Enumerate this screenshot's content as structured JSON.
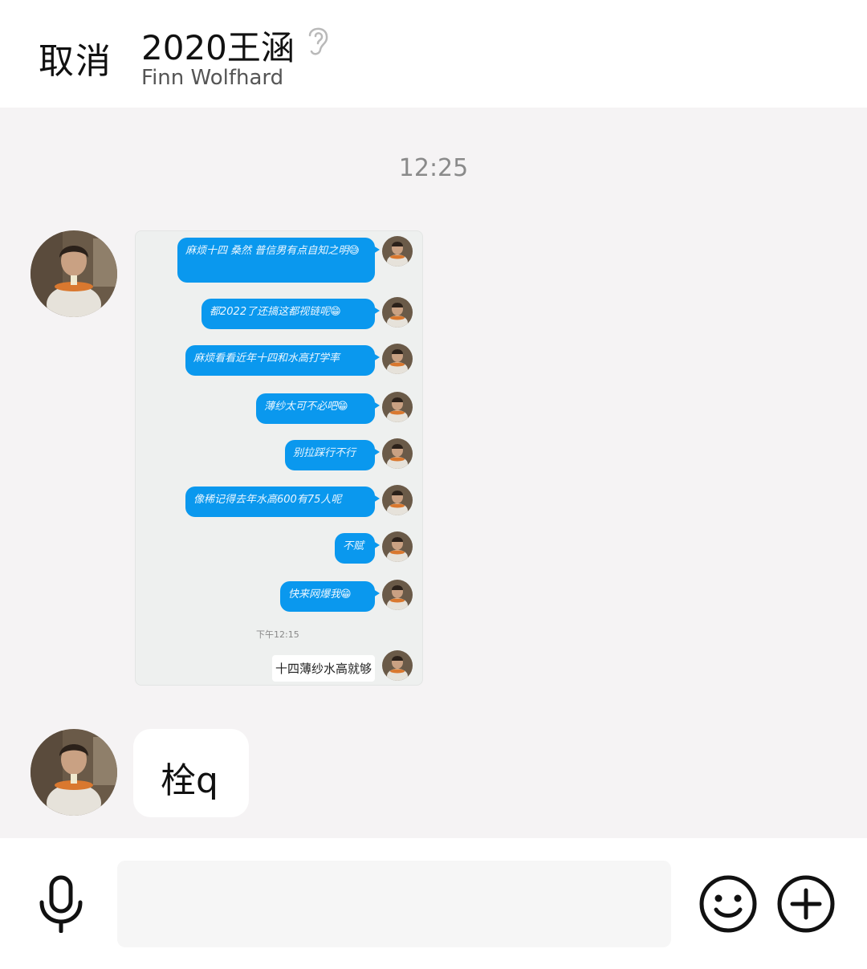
{
  "header": {
    "cancel_label": "取消",
    "title": "2020王涵",
    "subtitle": "Finn Wolfhard"
  },
  "chat": {
    "timestamp": "12:25",
    "screenshot": {
      "bubbles": [
        "麻烦十四 桑然 普信男有点自知之明😅",
        "都2022了还搞这都视链呢😁",
        "麻烦看看近年十四和水高打学率",
        "薄纱太可不必吧😁",
        "别拉踩行不行",
        "像稀记得去年水高600有75人呢",
        "不赋",
        "快来网爆我😁"
      ],
      "time": "下午12:15",
      "last_message": "十四薄纱水高就够"
    },
    "message_2": "栓q"
  },
  "input": {
    "placeholder": ""
  },
  "colors": {
    "bubble_blue": "#0a98ee",
    "background": "#f5f3f4"
  },
  "icons": [
    "ear-icon",
    "microphone-icon",
    "emoji-icon",
    "plus-icon"
  ]
}
